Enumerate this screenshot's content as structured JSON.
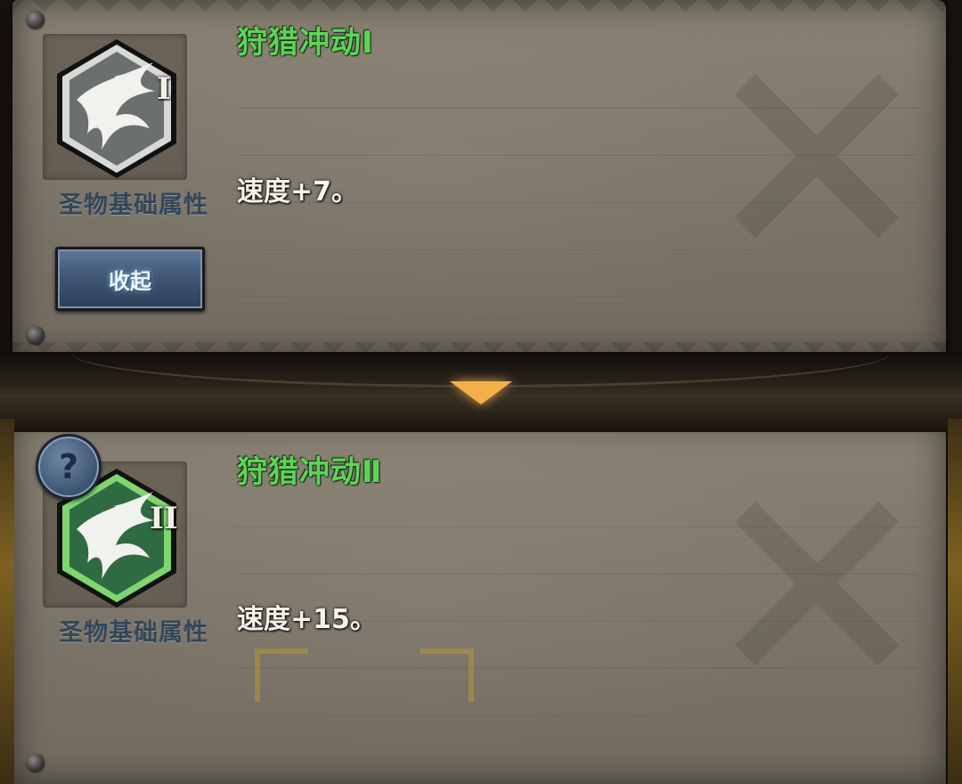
{
  "tiers": [
    {
      "title": "狩猎冲动Ⅰ",
      "roman": "I",
      "caption": "圣物基础属性",
      "effect": "速度+7。",
      "icon": "hunting-impulse-icon",
      "icon_color": "#6b706f"
    },
    {
      "title": "狩猎冲动Ⅱ",
      "roman": "II",
      "caption": "圣物基础属性",
      "effect": "速度+15。",
      "icon": "hunting-impulse-icon",
      "icon_color": "#2f6b42"
    }
  ],
  "buttons": {
    "collapse_label": "收起",
    "help_label": "?"
  },
  "colors": {
    "title_green": "#5fd25a",
    "caption_blue": "#33475a",
    "arrow_gold": "#f3b04a"
  }
}
